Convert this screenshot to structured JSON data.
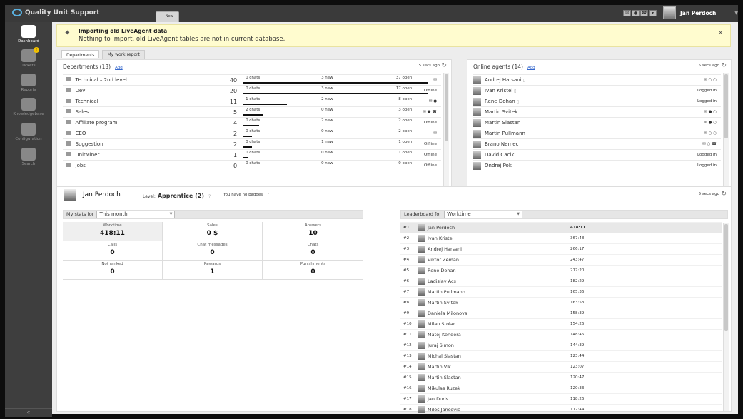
{
  "app": {
    "title": "Quality Unit Support",
    "new_button": "+ New"
  },
  "user": {
    "name": "Jan Perdoch"
  },
  "sidebar": {
    "items": [
      {
        "label": "Dashboard",
        "icon": "dashboard-icon",
        "active": true
      },
      {
        "label": "Tickets",
        "icon": "tickets-icon",
        "badge": "!"
      },
      {
        "label": "Reports",
        "icon": "reports-icon"
      },
      {
        "label": "Knowledgebase",
        "icon": "knowledgebase-icon"
      },
      {
        "label": "Configuration",
        "icon": "configuration-icon"
      },
      {
        "label": "Search",
        "icon": "search-icon"
      }
    ],
    "collapse": "«"
  },
  "notice": {
    "title": "Importing old LiveAgent data",
    "message": "Nothing to import, old LiveAgent tables are not in current database.",
    "close": "×"
  },
  "tabs": [
    "Departments",
    "My work report"
  ],
  "departments": {
    "title": "Departments (13)",
    "add": "Add",
    "updated": "5 secs ago",
    "rows": [
      {
        "name": "Technical – 2nd level",
        "count": "40",
        "chats": "0 chats",
        "new": "3 new",
        "open": "37 open",
        "bar": 1.0,
        "status": "",
        "icons": "✉"
      },
      {
        "name": "Dev",
        "count": "20",
        "chats": "0 chats",
        "new": "3 new",
        "open": "17 open",
        "bar": 1.0,
        "status": "Offline",
        "icons": ""
      },
      {
        "name": "Technical",
        "count": "11",
        "chats": "1 chats",
        "new": "2 new",
        "open": "8 open",
        "bar": 0.24,
        "status": "",
        "icons": "✉ ●"
      },
      {
        "name": "Sales",
        "count": "5",
        "chats": "2 chats",
        "new": "0 new",
        "open": "3 open",
        "bar": 0.11,
        "status": "",
        "icons": "✉ ● ☎"
      },
      {
        "name": "Affiliate program",
        "count": "4",
        "chats": "0 chats",
        "new": "2 new",
        "open": "2 open",
        "bar": 0.09,
        "status": "Offline",
        "icons": ""
      },
      {
        "name": "CEO",
        "count": "2",
        "chats": "0 chats",
        "new": "0 new",
        "open": "2 open",
        "bar": 0.05,
        "status": "",
        "icons": "✉"
      },
      {
        "name": "Suggestion",
        "count": "2",
        "chats": "0 chats",
        "new": "1 new",
        "open": "1 open",
        "bar": 0.05,
        "status": "Offline",
        "icons": ""
      },
      {
        "name": "UnitMiner",
        "count": "1",
        "chats": "0 chats",
        "new": "0 new",
        "open": "1 open",
        "bar": 0.03,
        "status": "Offline",
        "icons": ""
      },
      {
        "name": "Jobs",
        "count": "0",
        "chats": "0 chats",
        "new": "0 new",
        "open": "0 open",
        "bar": 0,
        "status": "Offline",
        "icons": ""
      }
    ]
  },
  "agents": {
    "title": "Online agents (14)",
    "add": "Add",
    "updated": "5 secs ago",
    "rows": [
      {
        "name": "Andrej Harsani",
        "phone": true,
        "status": "",
        "icons": "✉ ○ ○"
      },
      {
        "name": "Ivan Kristel",
        "phone": true,
        "status": "Logged in",
        "icons": ""
      },
      {
        "name": "Rene Dohan",
        "phone": true,
        "status": "Logged in",
        "icons": ""
      },
      {
        "name": "Martin Svitek",
        "phone": false,
        "status": "",
        "icons": "✉ ● ○"
      },
      {
        "name": "Martin Slastan",
        "phone": false,
        "status": "",
        "icons": "✉ ● ○"
      },
      {
        "name": "Martin Pullmann",
        "phone": false,
        "status": "",
        "icons": "✉ ○ ○"
      },
      {
        "name": "Brano Nemec",
        "phone": false,
        "status": "",
        "icons": "✉ ○ ☎"
      },
      {
        "name": "David Cacik",
        "phone": false,
        "status": "Logged in",
        "icons": ""
      },
      {
        "name": "Ondrej Pok",
        "phone": false,
        "status": "Logged in",
        "icons": ""
      }
    ]
  },
  "me": {
    "name": "Jan Perdoch",
    "level_label": "Level:",
    "level": "Apprentice (2)",
    "badges": "You have no badges",
    "updated": "5 secs ago",
    "stats_label": "My stats for",
    "stats_period": "This month",
    "stats": [
      {
        "label": "Worktime",
        "value": "418:11"
      },
      {
        "label": "Sales",
        "value": "0 $"
      },
      {
        "label": "Answers",
        "value": "10"
      },
      {
        "label": "Calls",
        "value": "0"
      },
      {
        "label": "Chat messages",
        "value": "0"
      },
      {
        "label": "Chats",
        "value": "0"
      },
      {
        "label": "Not ranked",
        "value": "0"
      },
      {
        "label": "Rewards",
        "value": "1"
      },
      {
        "label": "Punishments",
        "value": "0"
      }
    ],
    "leaderboard_label": "Leaderboard for",
    "leaderboard_metric": "Worktime",
    "leaderboard": [
      {
        "rank": "#1",
        "name": "Jan Perdoch",
        "time": "418:11"
      },
      {
        "rank": "#2",
        "name": "Ivan Kristel",
        "time": "367:48"
      },
      {
        "rank": "#3",
        "name": "Andrej Harsani",
        "time": "266:17"
      },
      {
        "rank": "#4",
        "name": "Viktor Zeman",
        "time": "243:47"
      },
      {
        "rank": "#5",
        "name": "Rene Dohan",
        "time": "217:20"
      },
      {
        "rank": "#6",
        "name": "Ladislav Acs",
        "time": "182:29"
      },
      {
        "rank": "#7",
        "name": "Martin Pullmann",
        "time": "165:36"
      },
      {
        "rank": "#8",
        "name": "Martin Svitek",
        "time": "163:53"
      },
      {
        "rank": "#9",
        "name": "Daniela Milonova",
        "time": "158:39"
      },
      {
        "rank": "#10",
        "name": "Milan Stolar",
        "time": "154:26"
      },
      {
        "rank": "#11",
        "name": "Matej Kendera",
        "time": "148:46"
      },
      {
        "rank": "#12",
        "name": "Juraj Simon",
        "time": "144:39"
      },
      {
        "rank": "#13",
        "name": "Michal Slastan",
        "time": "123:44"
      },
      {
        "rank": "#14",
        "name": "Martin Vlk",
        "time": "123:07"
      },
      {
        "rank": "#15",
        "name": "Martin Slastan",
        "time": "120:47"
      },
      {
        "rank": "#16",
        "name": "Mikulas Ruzek",
        "time": "120:33"
      },
      {
        "rank": "#17",
        "name": "Jan Duris",
        "time": "118:26"
      },
      {
        "rank": "#18",
        "name": "Miloš Jančovič",
        "time": "112:44"
      }
    ]
  }
}
